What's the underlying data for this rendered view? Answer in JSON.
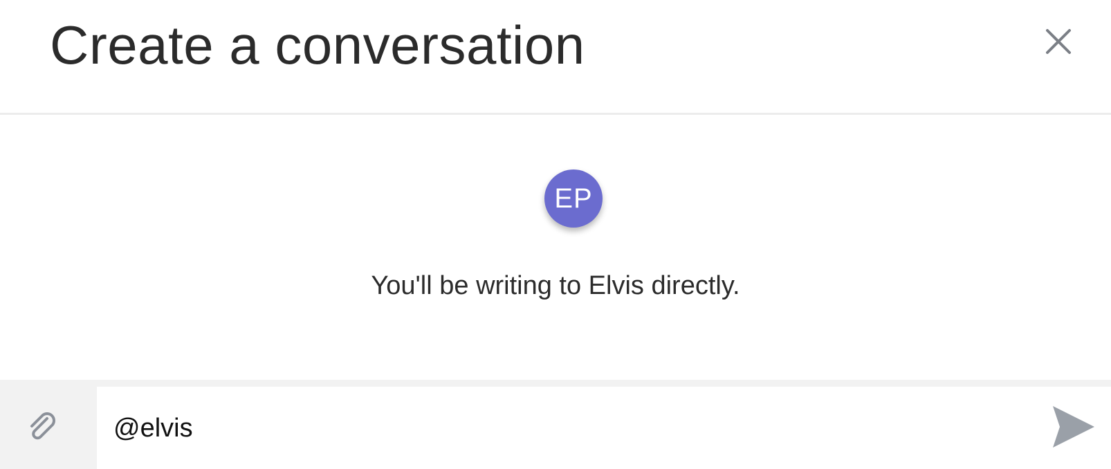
{
  "dialog": {
    "title": "Create a conversation",
    "close_icon": "close-icon"
  },
  "recipient": {
    "avatar_initials": "EP",
    "avatar_color": "#6b6ccf",
    "info_text": "You'll be writing to Elvis directly."
  },
  "composer": {
    "attach_icon": "paperclip-icon",
    "input_value": "@elvis",
    "send_icon": "send-icon"
  },
  "colors": {
    "title_text": "#2b2b2b",
    "icon_gray": "#9aa0a8",
    "composer_bg": "#f2f2f2"
  }
}
